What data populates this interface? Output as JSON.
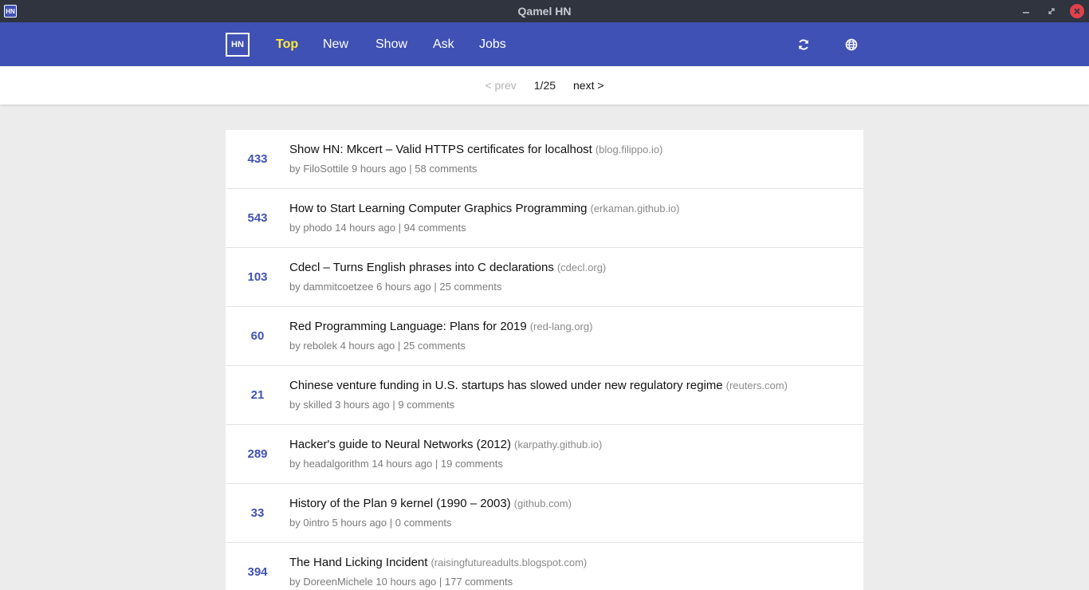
{
  "window": {
    "title": "Qamel HN",
    "app_icon_label": "HN",
    "icons": [
      "minimize-icon",
      "restore-icon",
      "close-icon"
    ]
  },
  "toolbar": {
    "logo_label": "HN",
    "tabs": [
      {
        "label": "Top",
        "active": true
      },
      {
        "label": "New",
        "active": false
      },
      {
        "label": "Show",
        "active": false
      },
      {
        "label": "Ask",
        "active": false
      },
      {
        "label": "Jobs",
        "active": false
      }
    ],
    "icons": [
      "refresh-icon",
      "globe-icon"
    ]
  },
  "pager": {
    "prev_label": "< prev",
    "page_label": "1/25",
    "next_label": "next >"
  },
  "stories": [
    {
      "score": "433",
      "title": "Show HN: Mkcert – Valid HTTPS certificates for localhost",
      "domain": "(blog.filippo.io)",
      "meta": "by FiloSottile 9 hours ago | 58 comments"
    },
    {
      "score": "543",
      "title": "How to Start Learning Computer Graphics Programming",
      "domain": "(erkaman.github.io)",
      "meta": "by phodo 14 hours ago | 94 comments"
    },
    {
      "score": "103",
      "title": "Cdecl – Turns English phrases into C declarations",
      "domain": "(cdecl.org)",
      "meta": "by dammitcoetzee 6 hours ago | 25 comments"
    },
    {
      "score": "60",
      "title": "Red Programming Language: Plans for 2019",
      "domain": "(red-lang.org)",
      "meta": "by rebolek 4 hours ago | 25 comments"
    },
    {
      "score": "21",
      "title": "Chinese venture funding in U.S. startups has slowed under new regulatory regime",
      "domain": "(reuters.com)",
      "meta": "by skilled 3 hours ago | 9 comments"
    },
    {
      "score": "289",
      "title": "Hacker's guide to Neural Networks (2012)",
      "domain": "(karpathy.github.io)",
      "meta": "by headalgorithm 14 hours ago | 19 comments"
    },
    {
      "score": "33",
      "title": "History of the Plan 9 kernel (1990 – 2003)",
      "domain": "(github.com)",
      "meta": "by 0intro 5 hours ago | 0 comments"
    },
    {
      "score": "394",
      "title": "The Hand Licking Incident",
      "domain": "(raisingfutureadults.blogspot.com)",
      "meta": "by DoreenMichele 10 hours ago | 177 comments"
    }
  ],
  "colors": {
    "accent": "#3f51b5",
    "active_tab": "#ffeb3b",
    "titlebar": "#2f343f",
    "close_button": "#e0414b"
  }
}
